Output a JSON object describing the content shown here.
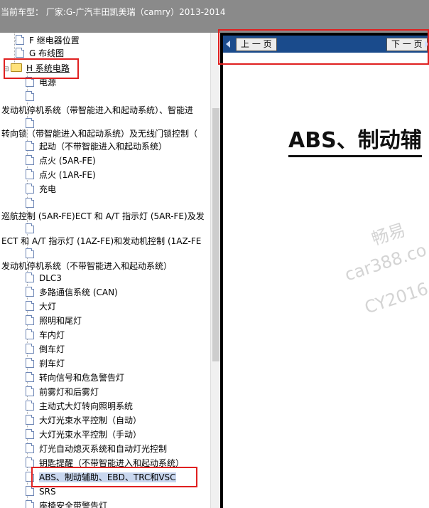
{
  "header": {
    "title": "当前车型： 厂家:G-广汽丰田凯美瑞（camry）2013-2014"
  },
  "tree": {
    "items": [
      {
        "label": "F 继电器位置",
        "kind": "doc"
      },
      {
        "label": "G 布线图",
        "kind": "doc"
      },
      {
        "label": "H 系统电路",
        "kind": "folder",
        "expander": "⊟"
      },
      {
        "label": "电源",
        "kind": "doc"
      },
      {
        "label": "",
        "kind": "doc"
      },
      {
        "label": "发动机停机系统（带智能进入和起动系统）、智能进",
        "kind": "text"
      },
      {
        "label": "",
        "kind": "doc"
      },
      {
        "label": "转向锁（带智能进入和起动系统）及无线门锁控制（",
        "kind": "text"
      },
      {
        "label": "起动（不带智能进入和起动系统）",
        "kind": "doc"
      },
      {
        "label": "点火 (5AR-FE)",
        "kind": "doc"
      },
      {
        "label": "点火 (1AR-FE)",
        "kind": "doc"
      },
      {
        "label": "充电",
        "kind": "doc"
      },
      {
        "label": "",
        "kind": "doc"
      },
      {
        "label": "巡航控制 (5AR-FE)ECT 和 A/T 指示灯 (5AR-FE)及发",
        "kind": "text"
      },
      {
        "label": "",
        "kind": "doc"
      },
      {
        "label": "ECT 和 A/T 指示灯 (1AZ-FE)和发动机控制 (1AZ-FE",
        "kind": "text"
      },
      {
        "label": "",
        "kind": "doc"
      },
      {
        "label": "发动机停机系统（不带智能进入和起动系统）",
        "kind": "text"
      },
      {
        "label": "DLC3",
        "kind": "doc"
      },
      {
        "label": "多路通信系统 (CAN)",
        "kind": "doc"
      },
      {
        "label": "大灯",
        "kind": "doc"
      },
      {
        "label": "照明和尾灯",
        "kind": "doc"
      },
      {
        "label": "车内灯",
        "kind": "doc"
      },
      {
        "label": "倒车灯",
        "kind": "doc"
      },
      {
        "label": "刹车灯",
        "kind": "doc"
      },
      {
        "label": "转向信号和危急警告灯",
        "kind": "doc"
      },
      {
        "label": "前雾灯和后雾灯",
        "kind": "doc"
      },
      {
        "label": "主动式大灯转向照明系统",
        "kind": "doc"
      },
      {
        "label": "大灯光束水平控制（自动）",
        "kind": "doc"
      },
      {
        "label": "大灯光束水平控制（手动）",
        "kind": "doc"
      },
      {
        "label": "灯光自动熄灭系统和自动灯光控制",
        "kind": "doc"
      },
      {
        "label": "钥匙提醒（不带智能进入和起动系统）",
        "kind": "doc"
      },
      {
        "label": "ABS、制动辅助、EBD、TRC和VSC",
        "kind": "doc",
        "selected": true
      },
      {
        "label": "SRS",
        "kind": "doc"
      },
      {
        "label": "座椅安全带警告灯",
        "kind": "doc"
      }
    ]
  },
  "viewer": {
    "prev_label": "上 一 页",
    "next_label": "下 一 页",
    "doc_title": "ABS、制动辅",
    "watermark": [
      "畅易",
      "car388.co",
      "CY2016"
    ]
  },
  "colors": {
    "highlight": "#e02020",
    "navbar": "#1a4b8c",
    "header": "#8a8a8a"
  }
}
